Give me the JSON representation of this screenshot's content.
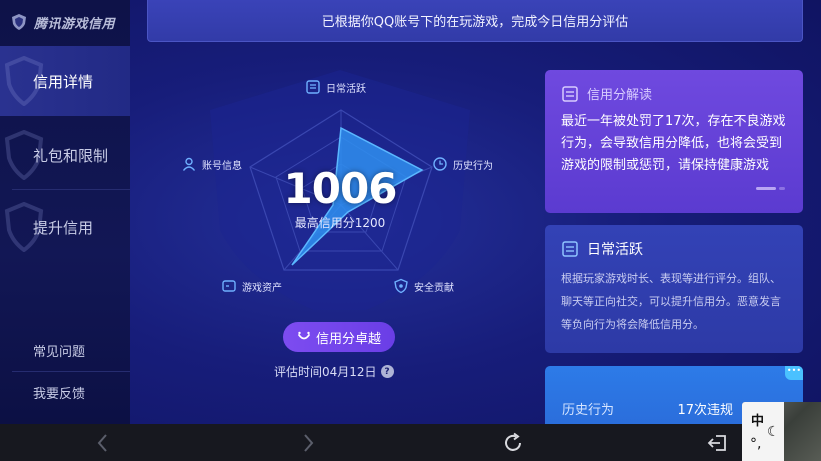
{
  "sidebar": {
    "brand": "腾讯游戏信用",
    "items": [
      {
        "label": "信用详情"
      },
      {
        "label": "礼包和限制"
      },
      {
        "label": "提升信用"
      }
    ],
    "footer_items": [
      {
        "label": "常见问题"
      },
      {
        "label": "我要反馈"
      }
    ]
  },
  "banner": {
    "text": "已根据你QQ账号下的在玩游戏，完成今日信用分评估"
  },
  "radar": {
    "labels": {
      "daily": "日常活跃",
      "history": "历史行为",
      "security": "安全贡献",
      "assets": "游戏资产",
      "account": "账号信息"
    },
    "score": "1006",
    "max_label": "最高信用分1200"
  },
  "level_button": {
    "label": "信用分卓越"
  },
  "eval_time": {
    "text": "评估时间04月12日",
    "help": "?"
  },
  "cards": {
    "interpret": {
      "title": "信用分解读",
      "body": "最近一年被处罚了17次，存在不良游戏行为，会导致信用分降低，也将会受到游戏的限制或惩罚，请保持健康游戏"
    },
    "daily": {
      "title": "日常活跃",
      "body": "根据玩家游戏时长、表现等进行评分。组队、聊天等正向社交，可以提升信用分。恶意发言等负向行为将会降低信用分。"
    },
    "history": {
      "label": "历史行为",
      "value": "17次违规",
      "corner": "•••"
    }
  },
  "ime": {
    "zh": "中",
    "moon": "☾",
    "punct": "°,"
  },
  "colors": {
    "accent_purple": "#6a3ee6",
    "radar_fill": "#2f8ff0",
    "card_blue": "#2a6bd9",
    "background": "#171d7a"
  },
  "icons": {
    "back": "chevron-left-icon",
    "forward": "chevron-right-icon",
    "refresh": "refresh-icon",
    "exit": "exit-icon"
  }
}
